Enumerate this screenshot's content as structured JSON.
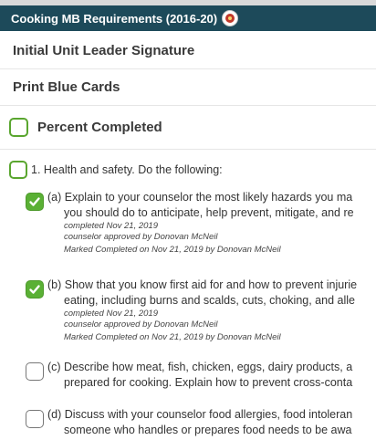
{
  "header": {
    "title": "Cooking MB Requirements (2016-20)",
    "emblem_icon": "merit-badge-emblem-icon",
    "bg_color": "#1d4a5a"
  },
  "links": {
    "initial_signature": "Initial Unit Leader Signature",
    "print_cards": "Print Blue Cards"
  },
  "percent": {
    "label": "Percent Completed"
  },
  "requirement": {
    "label": "1. Health and safety. Do the following:",
    "subs": [
      {
        "checked": true,
        "line1": "(a) Explain to your counselor the most likely hazards you ma",
        "line2": "you should do to anticipate, help prevent, mitigate, and re",
        "completed": "completed Nov 21, 2019",
        "approved": "counselor approved by Donovan McNeil",
        "marked": "Marked Completed on Nov 21, 2019 by Donovan McNeil"
      },
      {
        "checked": true,
        "line1": "(b) Show that you know first aid for and how to prevent injurie",
        "line2": "eating, including burns and scalds, cuts, choking, and alle",
        "completed": "completed Nov 21, 2019",
        "approved": "counselor approved by Donovan McNeil",
        "marked": "Marked Completed on Nov 21, 2019 by Donovan McNeil"
      },
      {
        "checked": false,
        "line1": "(c) Describe how meat, fish, chicken, eggs, dairy products, a",
        "line2": "prepared for cooking. Explain how to prevent cross-conta"
      },
      {
        "checked": false,
        "line1": "(d) Discuss with your counselor food allergies, food intoleran",
        "line2": "someone who handles or prepares food needs to be awa"
      }
    ]
  },
  "colors": {
    "check_green": "#5ab035",
    "divider": "#e6e6e6"
  }
}
